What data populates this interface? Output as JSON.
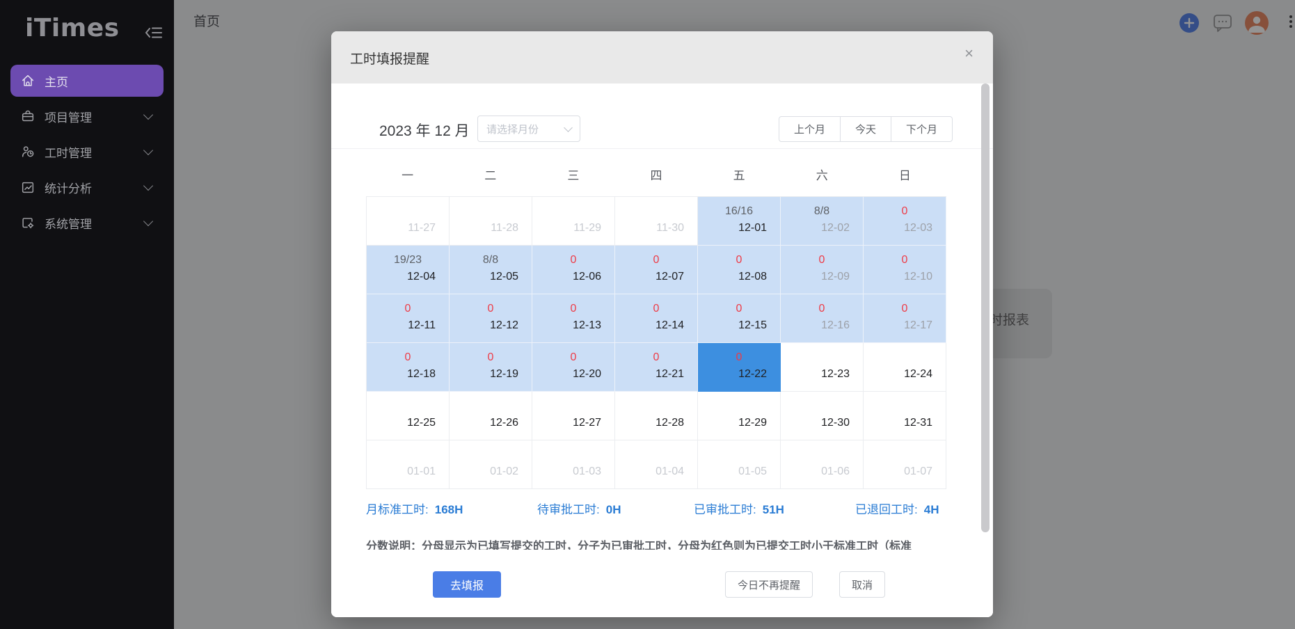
{
  "sidebar": {
    "logo": "iTimes",
    "items": [
      {
        "label": "主页",
        "icon": "home-icon",
        "active": true,
        "expandable": false
      },
      {
        "label": "项目管理",
        "icon": "project-icon",
        "active": false,
        "expandable": true
      },
      {
        "label": "工时管理",
        "icon": "timesheet-icon",
        "active": false,
        "expandable": true
      },
      {
        "label": "统计分析",
        "icon": "analytics-icon",
        "active": false,
        "expandable": true
      },
      {
        "label": "系统管理",
        "icon": "system-icon",
        "active": false,
        "expandable": true
      }
    ]
  },
  "topbar": {
    "breadcrumb": "首页",
    "icons": [
      "plus-icon",
      "chat-icon",
      "avatar",
      "kebab-icon"
    ]
  },
  "background": {
    "card_text": "时报表"
  },
  "modal": {
    "title": "工时填报提醒",
    "close": "×",
    "month_title": "2023 年 12 月",
    "month_select_placeholder": "请选择月份",
    "nav_buttons": [
      "上个月",
      "今天",
      "下个月"
    ],
    "stats": [
      {
        "label": "月标准工时:",
        "value": "168H"
      },
      {
        "label": "待审批工时:",
        "value": "0H"
      },
      {
        "label": "已审批工时:",
        "value": "51H"
      },
      {
        "label": "已退回工时:",
        "value": "4H"
      }
    ],
    "note": "分数说明：分母显示为已填写提交的工时，分子为已审批工时，分母为红色则为已提交工时小于标准工时（标准",
    "footer": {
      "primary": "去填报",
      "secondary": "今日不再提醒",
      "cancel": "取消"
    }
  },
  "calendar": {
    "weekdays": [
      "一",
      "二",
      "三",
      "四",
      "五",
      "六",
      "日"
    ],
    "cells": [
      {
        "date": "11-27",
        "value": "",
        "value_style": "gray",
        "bg": "white",
        "date_style": "faded"
      },
      {
        "date": "11-28",
        "value": "",
        "value_style": "gray",
        "bg": "white",
        "date_style": "faded"
      },
      {
        "date": "11-29",
        "value": "",
        "value_style": "gray",
        "bg": "white",
        "date_style": "faded"
      },
      {
        "date": "11-30",
        "value": "",
        "value_style": "gray",
        "bg": "white",
        "date_style": "faded"
      },
      {
        "date": "12-01",
        "value": "16/16",
        "value_style": "gray",
        "bg": "blue",
        "date_style": "normal"
      },
      {
        "date": "12-02",
        "value": "8/8",
        "value_style": "gray",
        "bg": "blue",
        "date_style": "muted"
      },
      {
        "date": "12-03",
        "value": "0",
        "value_style": "red",
        "bg": "blue",
        "date_style": "muted"
      },
      {
        "date": "12-04",
        "value": "19/23",
        "value_style": "gray",
        "bg": "blue",
        "date_style": "normal"
      },
      {
        "date": "12-05",
        "value": "8/8",
        "value_style": "gray",
        "bg": "blue",
        "date_style": "normal"
      },
      {
        "date": "12-06",
        "value": "0",
        "value_style": "red",
        "bg": "blue",
        "date_style": "normal"
      },
      {
        "date": "12-07",
        "value": "0",
        "value_style": "red",
        "bg": "blue",
        "date_style": "normal"
      },
      {
        "date": "12-08",
        "value": "0",
        "value_style": "red",
        "bg": "blue",
        "date_style": "normal"
      },
      {
        "date": "12-09",
        "value": "0",
        "value_style": "red",
        "bg": "blue",
        "date_style": "muted"
      },
      {
        "date": "12-10",
        "value": "0",
        "value_style": "red",
        "bg": "blue",
        "date_style": "muted"
      },
      {
        "date": "12-11",
        "value": "0",
        "value_style": "red",
        "bg": "blue",
        "date_style": "normal"
      },
      {
        "date": "12-12",
        "value": "0",
        "value_style": "red",
        "bg": "blue",
        "date_style": "normal"
      },
      {
        "date": "12-13",
        "value": "0",
        "value_style": "red",
        "bg": "blue",
        "date_style": "normal"
      },
      {
        "date": "12-14",
        "value": "0",
        "value_style": "red",
        "bg": "blue",
        "date_style": "normal"
      },
      {
        "date": "12-15",
        "value": "0",
        "value_style": "red",
        "bg": "blue",
        "date_style": "normal"
      },
      {
        "date": "12-16",
        "value": "0",
        "value_style": "red",
        "bg": "blue",
        "date_style": "muted"
      },
      {
        "date": "12-17",
        "value": "0",
        "value_style": "red",
        "bg": "blue",
        "date_style": "muted"
      },
      {
        "date": "12-18",
        "value": "0",
        "value_style": "red",
        "bg": "blue",
        "date_style": "normal"
      },
      {
        "date": "12-19",
        "value": "0",
        "value_style": "red",
        "bg": "blue",
        "date_style": "normal"
      },
      {
        "date": "12-20",
        "value": "0",
        "value_style": "red",
        "bg": "blue",
        "date_style": "normal"
      },
      {
        "date": "12-21",
        "value": "0",
        "value_style": "red",
        "bg": "blue",
        "date_style": "normal"
      },
      {
        "date": "12-22",
        "value": "0",
        "value_style": "red",
        "bg": "selected",
        "date_style": "normal"
      },
      {
        "date": "12-23",
        "value": "",
        "value_style": "gray",
        "bg": "white",
        "date_style": "normal"
      },
      {
        "date": "12-24",
        "value": "",
        "value_style": "gray",
        "bg": "white",
        "date_style": "normal"
      },
      {
        "date": "12-25",
        "value": "",
        "value_style": "gray",
        "bg": "white",
        "date_style": "normal"
      },
      {
        "date": "12-26",
        "value": "",
        "value_style": "gray",
        "bg": "white",
        "date_style": "normal"
      },
      {
        "date": "12-27",
        "value": "",
        "value_style": "gray",
        "bg": "white",
        "date_style": "normal"
      },
      {
        "date": "12-28",
        "value": "",
        "value_style": "gray",
        "bg": "white",
        "date_style": "normal"
      },
      {
        "date": "12-29",
        "value": "",
        "value_style": "gray",
        "bg": "white",
        "date_style": "normal"
      },
      {
        "date": "12-30",
        "value": "",
        "value_style": "gray",
        "bg": "white",
        "date_style": "normal"
      },
      {
        "date": "12-31",
        "value": "",
        "value_style": "gray",
        "bg": "white",
        "date_style": "normal"
      },
      {
        "date": "01-01",
        "value": "",
        "value_style": "gray",
        "bg": "white",
        "date_style": "faded"
      },
      {
        "date": "01-02",
        "value": "",
        "value_style": "gray",
        "bg": "white",
        "date_style": "faded"
      },
      {
        "date": "01-03",
        "value": "",
        "value_style": "gray",
        "bg": "white",
        "date_style": "faded"
      },
      {
        "date": "01-04",
        "value": "",
        "value_style": "gray",
        "bg": "white",
        "date_style": "faded"
      },
      {
        "date": "01-05",
        "value": "",
        "value_style": "gray",
        "bg": "white",
        "date_style": "faded"
      },
      {
        "date": "01-06",
        "value": "",
        "value_style": "gray",
        "bg": "white",
        "date_style": "faded"
      },
      {
        "date": "01-07",
        "value": "",
        "value_style": "gray",
        "bg": "white",
        "date_style": "faded"
      }
    ]
  },
  "colors": {
    "sidebar_active": "#6c4bb0",
    "primary_button": "#4a7de6",
    "cell_blue": "#cbdef6",
    "cell_selected": "#3d8fe0",
    "value_red": "#ee3b46",
    "stats_blue": "#2a7cd4"
  }
}
